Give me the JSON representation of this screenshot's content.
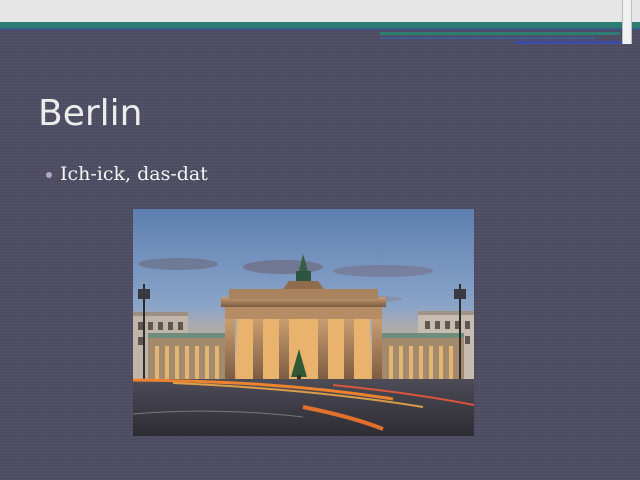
{
  "slide": {
    "title": "Berlin",
    "bullets": [
      "Ich-ick, das-dat"
    ],
    "image": {
      "subject": "Brandenburg Gate at dusk"
    }
  },
  "colors": {
    "background": "#4f4d63",
    "accent_teal": "#2e7d73",
    "accent_blue": "#3d4aa6",
    "bullet": "#b4a6c7"
  }
}
